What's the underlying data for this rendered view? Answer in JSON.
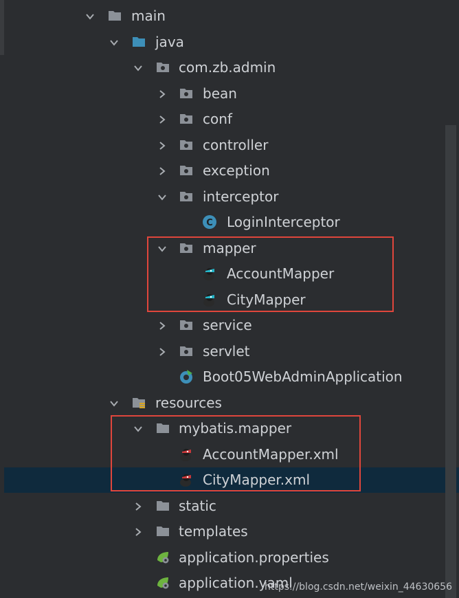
{
  "tree": [
    {
      "label": "main",
      "expanded": true,
      "icon": "folder",
      "depth": 0
    },
    {
      "label": "java",
      "expanded": true,
      "icon": "source-folder",
      "depth": 1
    },
    {
      "label": "com.zb.admin",
      "expanded": true,
      "icon": "package",
      "depth": 2
    },
    {
      "label": "bean",
      "expanded": false,
      "icon": "package",
      "depth": 3
    },
    {
      "label": "conf",
      "expanded": false,
      "icon": "package",
      "depth": 3
    },
    {
      "label": "controller",
      "expanded": false,
      "icon": "package",
      "depth": 3
    },
    {
      "label": "exception",
      "expanded": false,
      "icon": "package",
      "depth": 3
    },
    {
      "label": "interceptor",
      "expanded": true,
      "icon": "package",
      "depth": 3
    },
    {
      "label": "LoginInterceptor",
      "icon": "class",
      "depth": 4
    },
    {
      "label": "mapper",
      "expanded": true,
      "icon": "package",
      "depth": 3
    },
    {
      "label": "AccountMapper",
      "icon": "mybatis-mapper",
      "depth": 4
    },
    {
      "label": "CityMapper",
      "icon": "mybatis-mapper",
      "depth": 4
    },
    {
      "label": "service",
      "expanded": false,
      "icon": "package",
      "depth": 3
    },
    {
      "label": "servlet",
      "expanded": false,
      "icon": "package",
      "depth": 3
    },
    {
      "label": "Boot05WebAdminApplication",
      "icon": "spring-boot-app",
      "depth": 3
    },
    {
      "label": "resources",
      "expanded": true,
      "icon": "resources-folder",
      "depth": 1
    },
    {
      "label": "mybatis.mapper",
      "expanded": true,
      "icon": "folder",
      "depth": 2
    },
    {
      "label": "AccountMapper.xml",
      "icon": "mybatis-xml",
      "depth": 3
    },
    {
      "label": "CityMapper.xml",
      "icon": "mybatis-xml",
      "depth": 3,
      "selected": true
    },
    {
      "label": "static",
      "expanded": false,
      "icon": "folder",
      "depth": 2
    },
    {
      "label": "templates",
      "expanded": false,
      "icon": "folder",
      "depth": 2
    },
    {
      "label": "application.properties",
      "icon": "spring-config",
      "depth": 2
    },
    {
      "label": "application.yaml",
      "icon": "spring-config",
      "depth": 2
    }
  ],
  "watermark": "https://blog.csdn.net/weixin_44630656",
  "colors": {
    "background": "#2b2d30",
    "selection": "#0f2a3d",
    "highlight": "#e0463c",
    "text": "#cfd2d6"
  }
}
